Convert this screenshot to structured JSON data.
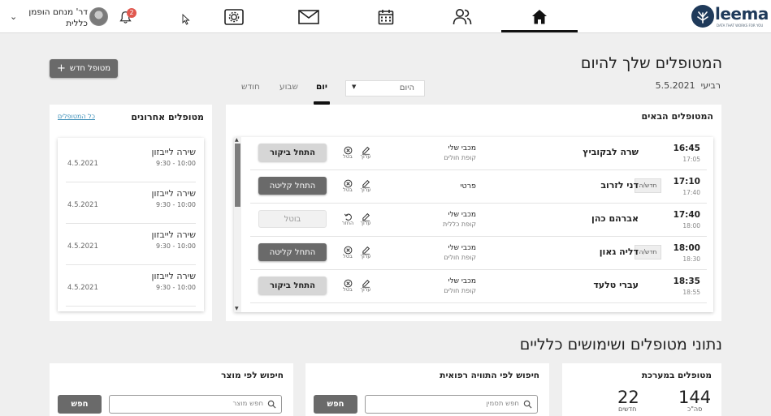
{
  "header": {
    "user_name": "דר' מנחם הופמן",
    "user_role": "כללית",
    "notification_count": "2",
    "logo_text": "leema",
    "logo_tagline": "DATA THAT WORKS FOR YOU"
  },
  "nav": [
    "home-icon",
    "users-icon",
    "calendar-icon",
    "mail-icon",
    "settings-icon"
  ],
  "page": {
    "title": "המטופלים שלך להיום",
    "day": "רביעי",
    "date": "5.5.2021",
    "new_patient_button": "מטופל חדש",
    "period_value": "היום",
    "tabs": [
      "יום",
      "שבוע",
      "חודש"
    ],
    "active_tab": "יום"
  },
  "upcoming": {
    "title": "המטופלים הבאים",
    "edit_label": "ערוך",
    "cancel_label": "בטל",
    "restore_label": "החזר",
    "rows": [
      {
        "start": "16:45",
        "end": "17:05",
        "patient": "שרה לבקוביץ",
        "tag": "",
        "ins1": "מכבי שלי",
        "ins2": "קופת חולים",
        "action": "התחל ביקור",
        "style": "light",
        "alt": "cancel"
      },
      {
        "start": "17:10",
        "end": "17:40",
        "patient": "דני לזרוב",
        "tag": "חדש/ה",
        "ins1": "פרטי",
        "ins2": "",
        "action": "התחל קליטה",
        "style": "dark",
        "alt": "cancel"
      },
      {
        "start": "17:40",
        "end": "18:00",
        "patient": "אברהם כהן",
        "tag": "",
        "ins1": "מכבי שלי",
        "ins2": "קופת כללית",
        "action": "בוטל",
        "style": "ghost",
        "alt": "restore"
      },
      {
        "start": "18:00",
        "end": "18:30",
        "patient": "דליה גאון",
        "tag": "חדש/ה",
        "ins1": "מכבי שלי",
        "ins2": "קופת חולים",
        "action": "התחל קליטה",
        "style": "dark",
        "alt": "cancel"
      },
      {
        "start": "18:35",
        "end": "18:55",
        "patient": "עברי טלעד",
        "tag": "",
        "ins1": "מכבי שלי",
        "ins2": "קופת חולים",
        "action": "התחל ביקור",
        "style": "light",
        "alt": "cancel"
      }
    ]
  },
  "recent": {
    "title": "מטופלים אחרונים",
    "all_link": "כל המטופלים",
    "items": [
      {
        "name": "שירה לייבזון",
        "time": "9:30 - 10:00",
        "date": "4.5.2021"
      },
      {
        "name": "שירה לייבזון",
        "time": "9:30 - 10:00",
        "date": "4.5.2021"
      },
      {
        "name": "שירה לייבזון",
        "time": "9:30 - 10:00",
        "date": "4.5.2021"
      },
      {
        "name": "שירה לייבזון",
        "time": "9:30 - 10:00",
        "date": "4.5.2021"
      }
    ]
  },
  "stats": {
    "title": "נתוני מטופלים ושימושים כלליים",
    "system": {
      "title": "מטופלים במערכת",
      "total": "144",
      "total_label": "סה\"כ",
      "new": "22",
      "new_label": "חדשים"
    },
    "diagnosis_search": {
      "title": "חיפוש לפי התוויה רפואית",
      "placeholder": "חפש תסמין",
      "button": "חפש"
    },
    "product_search": {
      "title": "חיפוש לפי מוצר",
      "placeholder": "חפש מוצר",
      "button": "חפש"
    }
  }
}
